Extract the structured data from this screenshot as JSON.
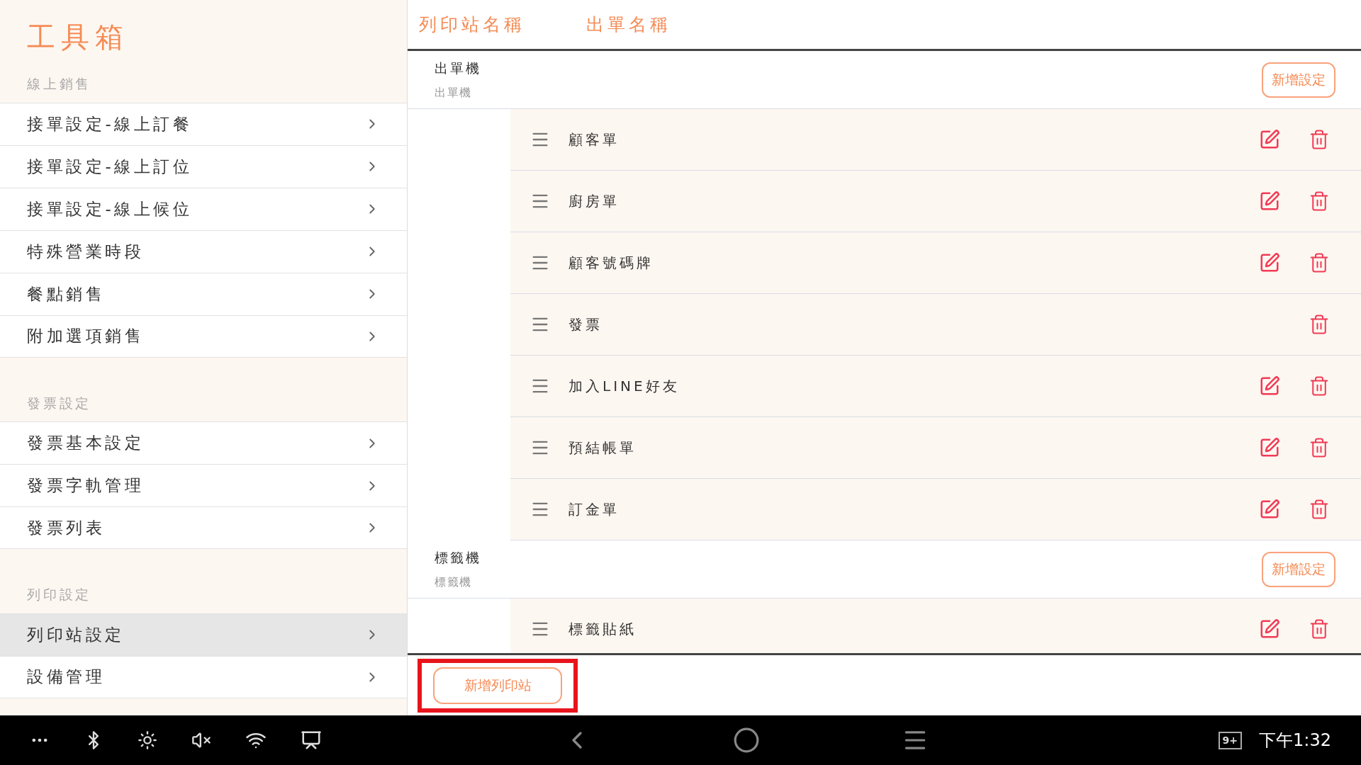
{
  "sidebar": {
    "title": "工具箱",
    "sections": [
      {
        "heading": "線上銷售",
        "items": [
          {
            "label": "接單設定-線上訂餐",
            "selected": false
          },
          {
            "label": "接單設定-線上訂位",
            "selected": false
          },
          {
            "label": "接單設定-線上候位",
            "selected": false
          },
          {
            "label": "特殊營業時段",
            "selected": false
          },
          {
            "label": "餐點銷售",
            "selected": false
          },
          {
            "label": "附加選項銷售",
            "selected": false
          }
        ]
      },
      {
        "heading": "發票設定",
        "items": [
          {
            "label": "發票基本設定",
            "selected": false
          },
          {
            "label": "發票字軌管理",
            "selected": false
          },
          {
            "label": "發票列表",
            "selected": false
          }
        ]
      },
      {
        "heading": "列印設定",
        "items": [
          {
            "label": "列印站設定",
            "selected": true
          },
          {
            "label": "設備管理",
            "selected": false
          }
        ]
      }
    ]
  },
  "columns": [
    "列印站名稱",
    "出單名稱"
  ],
  "stations": [
    {
      "name": "出單機",
      "subtitle": "出單機",
      "add_button": "新增設定",
      "items": [
        {
          "label": "顧客單",
          "editable": true
        },
        {
          "label": "廚房單",
          "editable": true
        },
        {
          "label": "顧客號碼牌",
          "editable": true
        },
        {
          "label": "發票",
          "editable": false
        },
        {
          "label": "加入LINE好友",
          "editable": true
        },
        {
          "label": "預結帳單",
          "editable": true
        },
        {
          "label": "訂金單",
          "editable": true
        }
      ]
    },
    {
      "name": "標籤機",
      "subtitle": "標籤機",
      "add_button": "新增設定",
      "items": [
        {
          "label": "標籤貼紙",
          "editable": true
        }
      ]
    }
  ],
  "add_station_button": "新增列印站",
  "taskbar": {
    "notification_count": "9+",
    "time": "下午1:32"
  }
}
